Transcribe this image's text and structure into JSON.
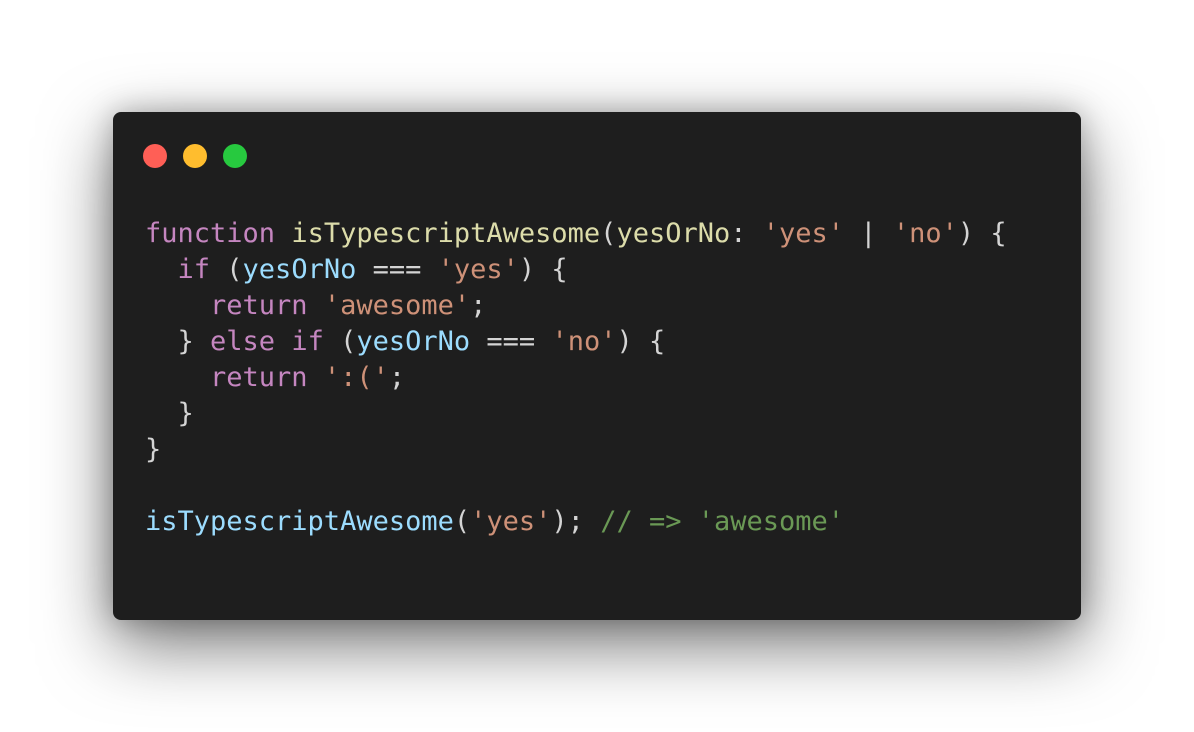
{
  "window_controls": [
    {
      "name": "close",
      "color": "#ff5f56"
    },
    {
      "name": "minimize",
      "color": "#ffbd2e"
    },
    {
      "name": "maximize",
      "color": "#27c93f"
    }
  ],
  "colors": {
    "editor_background": "#1e1e1e",
    "keyword": "#c586c0",
    "function_name": "#dcdcaa",
    "call_name": "#9cdcfe",
    "variable": "#9cdcfe",
    "string": "#ce9178",
    "comment": "#6a9955",
    "punctuation": "#d4d4d4"
  },
  "code": {
    "lines": [
      [
        {
          "text": "function",
          "kind": "kw"
        },
        {
          "text": " ",
          "kind": "plain"
        },
        {
          "text": "isTypescriptAwesome",
          "kind": "fn"
        },
        {
          "text": "(",
          "kind": "punc"
        },
        {
          "text": "yesOrNo",
          "kind": "param"
        },
        {
          "text": ": ",
          "kind": "punc"
        },
        {
          "text": "'yes'",
          "kind": "str"
        },
        {
          "text": " | ",
          "kind": "op"
        },
        {
          "text": "'no'",
          "kind": "str"
        },
        {
          "text": ") {",
          "kind": "punc"
        }
      ],
      [
        {
          "text": "  ",
          "kind": "plain"
        },
        {
          "text": "if",
          "kind": "kw"
        },
        {
          "text": " (",
          "kind": "punc"
        },
        {
          "text": "yesOrNo",
          "kind": "var"
        },
        {
          "text": " === ",
          "kind": "op"
        },
        {
          "text": "'yes'",
          "kind": "str"
        },
        {
          "text": ") {",
          "kind": "punc"
        }
      ],
      [
        {
          "text": "    ",
          "kind": "plain"
        },
        {
          "text": "return",
          "kind": "kw"
        },
        {
          "text": " ",
          "kind": "plain"
        },
        {
          "text": "'awesome'",
          "kind": "str"
        },
        {
          "text": ";",
          "kind": "punc"
        }
      ],
      [
        {
          "text": "  } ",
          "kind": "punc"
        },
        {
          "text": "else",
          "kind": "kw"
        },
        {
          "text": " ",
          "kind": "plain"
        },
        {
          "text": "if",
          "kind": "kw"
        },
        {
          "text": " (",
          "kind": "punc"
        },
        {
          "text": "yesOrNo",
          "kind": "var"
        },
        {
          "text": " === ",
          "kind": "op"
        },
        {
          "text": "'no'",
          "kind": "str"
        },
        {
          "text": ") {",
          "kind": "punc"
        }
      ],
      [
        {
          "text": "    ",
          "kind": "plain"
        },
        {
          "text": "return",
          "kind": "kw"
        },
        {
          "text": " ",
          "kind": "plain"
        },
        {
          "text": "':('",
          "kind": "str"
        },
        {
          "text": ";",
          "kind": "punc"
        }
      ],
      [
        {
          "text": "  }",
          "kind": "punc"
        }
      ],
      [
        {
          "text": "}",
          "kind": "punc"
        }
      ],
      [],
      [
        {
          "text": "isTypescriptAwesome",
          "kind": "fn2"
        },
        {
          "text": "(",
          "kind": "punc"
        },
        {
          "text": "'yes'",
          "kind": "str"
        },
        {
          "text": "); ",
          "kind": "punc"
        },
        {
          "text": "// => 'awesome'",
          "kind": "comment"
        }
      ]
    ]
  }
}
